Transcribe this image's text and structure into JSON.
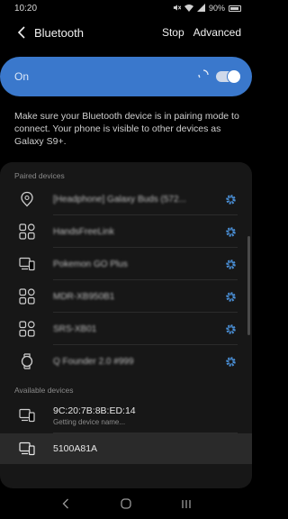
{
  "status_bar": {
    "time": "10:20",
    "battery": "90%"
  },
  "app_bar": {
    "title": "Bluetooth",
    "stop": "Stop",
    "advanced": "Advanced"
  },
  "toggle": {
    "label": "On",
    "state": "on",
    "accent": "#3a78cc"
  },
  "info": {
    "text": "Make sure your Bluetooth device is in pairing mode to connect. Your phone is visible to other devices as Galaxy S9+."
  },
  "paired": {
    "header": "Paired devices",
    "devices": [
      {
        "name": "[Headphone] Galaxy Buds (572...",
        "icon": "earbud-icon"
      },
      {
        "name": "HandsFreeLink",
        "icon": "bluetooth-generic-icon"
      },
      {
        "name": "Pokemon GO Plus",
        "icon": "phone-tablet-icon"
      },
      {
        "name": "MDR-XB950B1",
        "icon": "bluetooth-generic-icon"
      },
      {
        "name": "SRS-XB01",
        "icon": "bluetooth-generic-icon"
      },
      {
        "name": "Q Founder 2.0 #999",
        "icon": "watch-icon"
      }
    ]
  },
  "available": {
    "header": "Available devices",
    "devices": [
      {
        "name": "9C:20:7B:8B:ED:14",
        "status": "Getting device name...",
        "icon": "phone-tablet-icon"
      },
      {
        "name": "5100A81A",
        "icon": "phone-tablet-icon"
      }
    ]
  }
}
